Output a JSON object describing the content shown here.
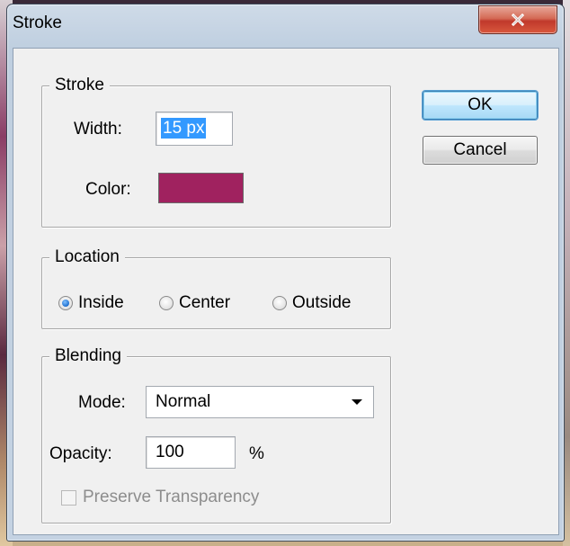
{
  "window": {
    "title": "Stroke",
    "close_glyph": "×"
  },
  "stroke_group": {
    "legend": "Stroke",
    "width_label": "Width:",
    "width_value": "15 px",
    "color_label": "Color:",
    "color_value": "#a0225f"
  },
  "location_group": {
    "legend": "Location",
    "options": [
      {
        "label": "Inside",
        "checked": true
      },
      {
        "label": "Center",
        "checked": false
      },
      {
        "label": "Outside",
        "checked": false
      }
    ]
  },
  "blending_group": {
    "legend": "Blending",
    "mode_label": "Mode:",
    "mode_value": "Normal",
    "opacity_label": "Opacity:",
    "opacity_value": "100",
    "opacity_unit": "%",
    "preserve_label": "Preserve Transparency",
    "preserve_checked": false,
    "preserve_enabled": false
  },
  "buttons": {
    "ok": "OK",
    "cancel": "Cancel"
  }
}
